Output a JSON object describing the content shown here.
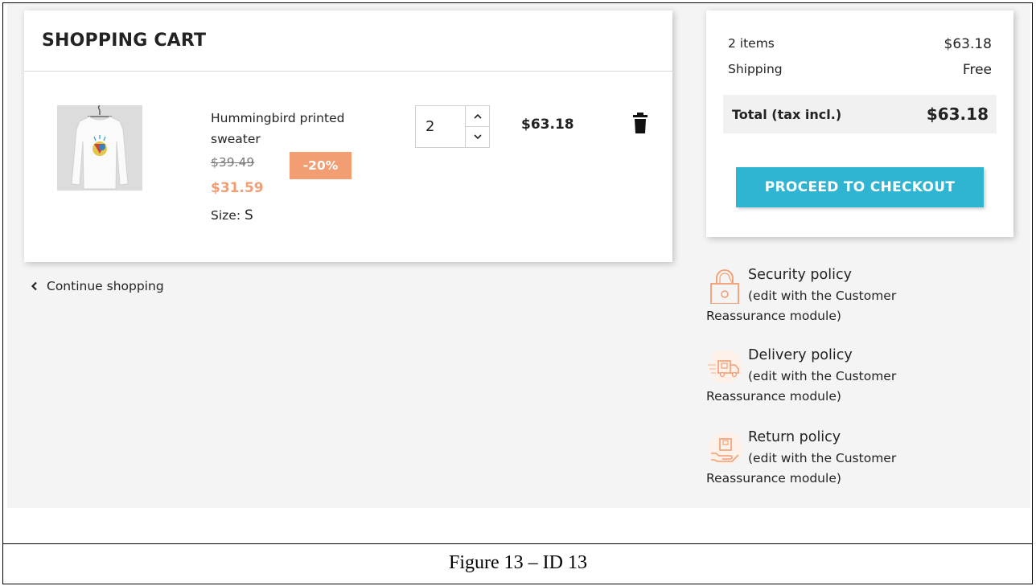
{
  "cart": {
    "title": "SHOPPING CART",
    "item": {
      "name": "Hummingbird printed sweater",
      "old_price": "$39.49",
      "discount": "-20%",
      "new_price": "$31.59",
      "size_label": "Size:",
      "size_value": "S",
      "quantity": "2",
      "line_total": "$63.18"
    },
    "continue_label": "Continue shopping"
  },
  "summary": {
    "items_label": "2 items",
    "items_value": "$63.18",
    "shipping_label": "Shipping",
    "shipping_value": "Free",
    "total_label": "Total (tax incl.)",
    "total_value": "$63.18",
    "checkout_label": "PROCEED TO CHECKOUT"
  },
  "reassurance": [
    {
      "title": "Security policy",
      "sub1": "(edit with the Customer",
      "sub2": "Reassurance module)",
      "icon": "lock-icon"
    },
    {
      "title": "Delivery policy",
      "sub1": "(edit with the Customer",
      "sub2": "Reassurance module)",
      "icon": "truck-icon"
    },
    {
      "title": "Return policy",
      "sub1": "(edit with the Customer",
      "sub2": "Reassurance module)",
      "icon": "return-box-icon"
    }
  ],
  "colors": {
    "accent": "#2fb5d2",
    "discount": "#f39d72",
    "page_background": "#f4f4f4"
  },
  "caption": "Figure 13 – ID  13"
}
